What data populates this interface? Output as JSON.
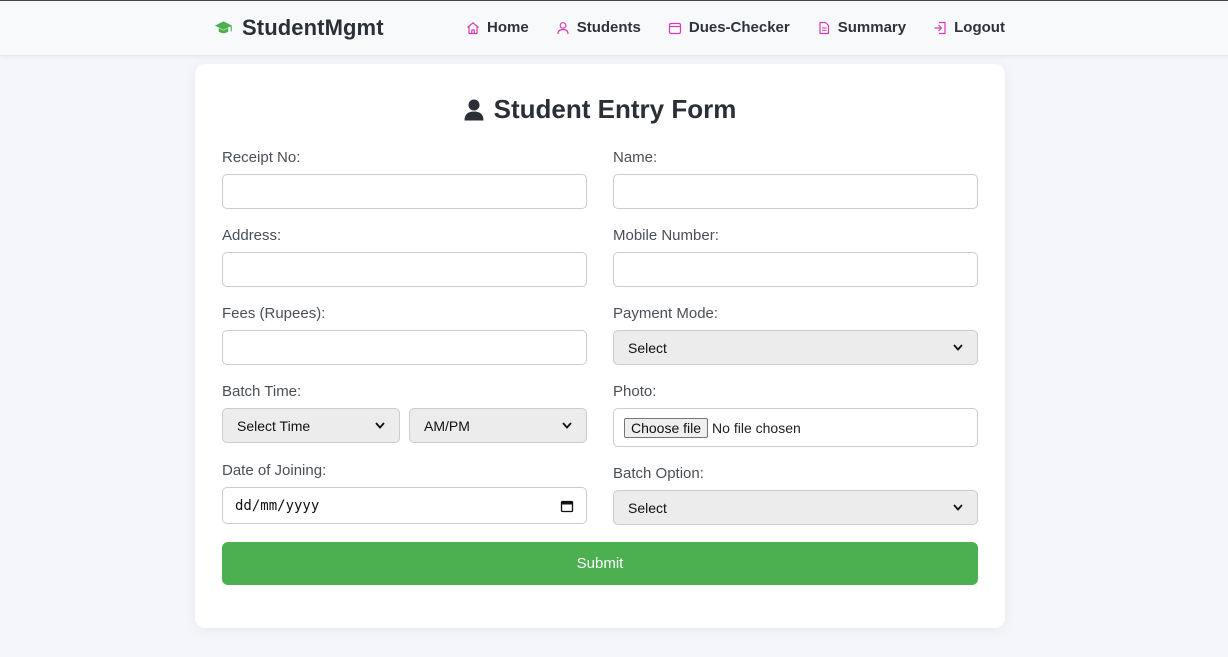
{
  "brand": {
    "name": "StudentMgmt",
    "icon": "graduation-cap-icon"
  },
  "nav": [
    {
      "label": "Home",
      "icon": "home-icon"
    },
    {
      "label": "Students",
      "icon": "user-icon"
    },
    {
      "label": "Dues-Checker",
      "icon": "calendar-icon"
    },
    {
      "label": "Summary",
      "icon": "document-icon"
    },
    {
      "label": "Logout",
      "icon": "logout-icon"
    }
  ],
  "colors": {
    "accent_pink": "#d63bb5",
    "brand_green": "#4caf50",
    "submit_green": "#4caf50"
  },
  "form": {
    "title": "Student Entry Form",
    "title_icon": "user-solid-icon",
    "receipt_label": "Receipt No:",
    "receipt_value": "",
    "name_label": "Name:",
    "name_value": "",
    "address_label": "Address:",
    "address_value": "",
    "mobile_label": "Mobile Number:",
    "mobile_value": "",
    "fees_label": "Fees (Rupees):",
    "fees_value": "",
    "payment_mode_label": "Payment Mode:",
    "payment_mode_value": "Select",
    "batch_time_label": "Batch Time:",
    "batch_time_value": "Select Time",
    "ampm_value": "AM/PM",
    "photo_label": "Photo:",
    "photo_button": "Choose file",
    "photo_status": "No file chosen",
    "doj_label": "Date of Joining:",
    "doj_value": "dd/mm/yyyy",
    "batch_option_label": "Batch Option:",
    "batch_option_value": "Select",
    "submit_label": "Submit"
  }
}
